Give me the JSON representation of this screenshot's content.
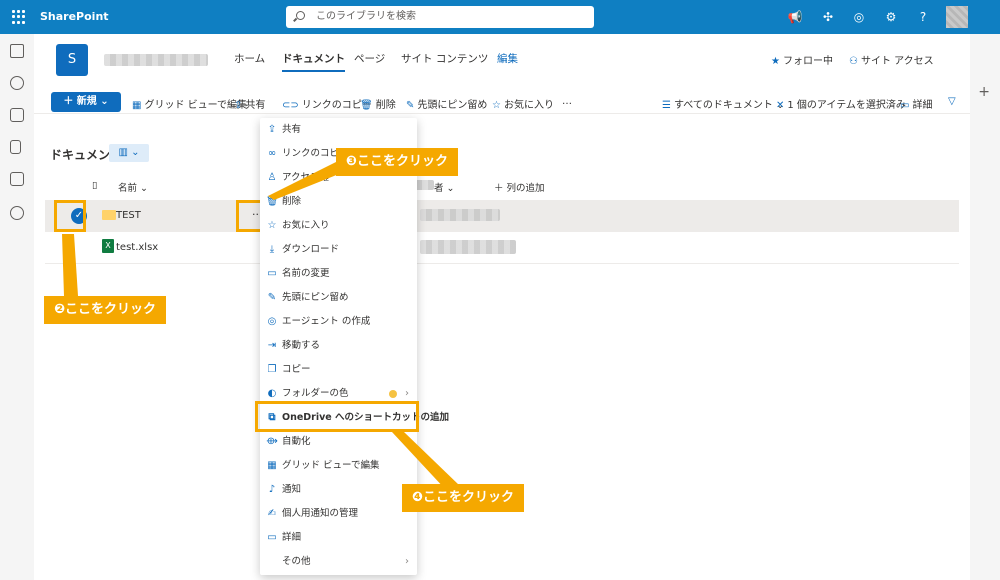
{
  "topbar": {
    "app_name": "SharePoint",
    "search_placeholder": "このライブラリを検索",
    "question_glyph": "?"
  },
  "site": {
    "logo_letter": "S",
    "nav": [
      "ホーム",
      "ドキュメント",
      "ページ",
      "サイト コンテンツ",
      "編集"
    ],
    "follow": "フォロー中",
    "access": "サイト アクセス"
  },
  "commandbar": {
    "new": "新規",
    "items": [
      "グリッド ビューで編集",
      "共有",
      "リンクのコピー",
      "削除",
      "先頭にピン留め",
      "お気に入り",
      "…"
    ],
    "view": "すべてのドキュメント",
    "selection": "1 個のアイテムを選択済み",
    "details": "詳細"
  },
  "library": {
    "title": "ドキュメント",
    "col_name": "名前",
    "col_modified_by_suffix": "者",
    "add_column": "列の追加",
    "rows": [
      {
        "name": "TEST",
        "type": "folder",
        "selected": true
      },
      {
        "name": "test.xlsx",
        "type": "excel",
        "selected": false
      }
    ]
  },
  "context_menu": {
    "items": [
      {
        "label": "共有",
        "icon": "share-icon"
      },
      {
        "label": "リンクのコピー",
        "icon": "link-icon"
      },
      {
        "label": "アクセス権",
        "icon": "person-icon"
      },
      {
        "label": "削除",
        "icon": "trash-icon"
      },
      {
        "label": "お気に入り",
        "icon": "star-icon"
      },
      {
        "label": "ダウンロード",
        "icon": "download-icon"
      },
      {
        "label": "名前の変更",
        "icon": "rename-icon"
      },
      {
        "label": "先頭にピン留め",
        "icon": "pin-icon"
      },
      {
        "label": "エージェント の作成",
        "icon": "agent-icon"
      },
      {
        "label": "移動する",
        "icon": "move-icon"
      },
      {
        "label": "コピー",
        "icon": "copy-icon"
      },
      {
        "label": "フォルダーの色",
        "icon": "palette-icon"
      },
      {
        "label": "OneDrive へのショートカットの追加",
        "icon": "shortcut-icon"
      },
      {
        "label": "自動化",
        "icon": "flow-icon"
      },
      {
        "label": "グリッド ビューで編集",
        "icon": "grid-icon"
      },
      {
        "label": "通知",
        "icon": "bell-icon"
      },
      {
        "label": "個人用通知の管理",
        "icon": "manage-alerts-icon"
      },
      {
        "label": "詳細",
        "icon": "details-icon"
      },
      {
        "label": "その他",
        "icon": "more-icon"
      }
    ]
  },
  "annotations": {
    "step2": "❷ここをクリック",
    "step3": "❸ここをクリック",
    "step4": "❹ここをクリック",
    "color": "#f5a800"
  },
  "colors": {
    "brand": "#0f7fc2",
    "accent": "#0f6cbd"
  }
}
